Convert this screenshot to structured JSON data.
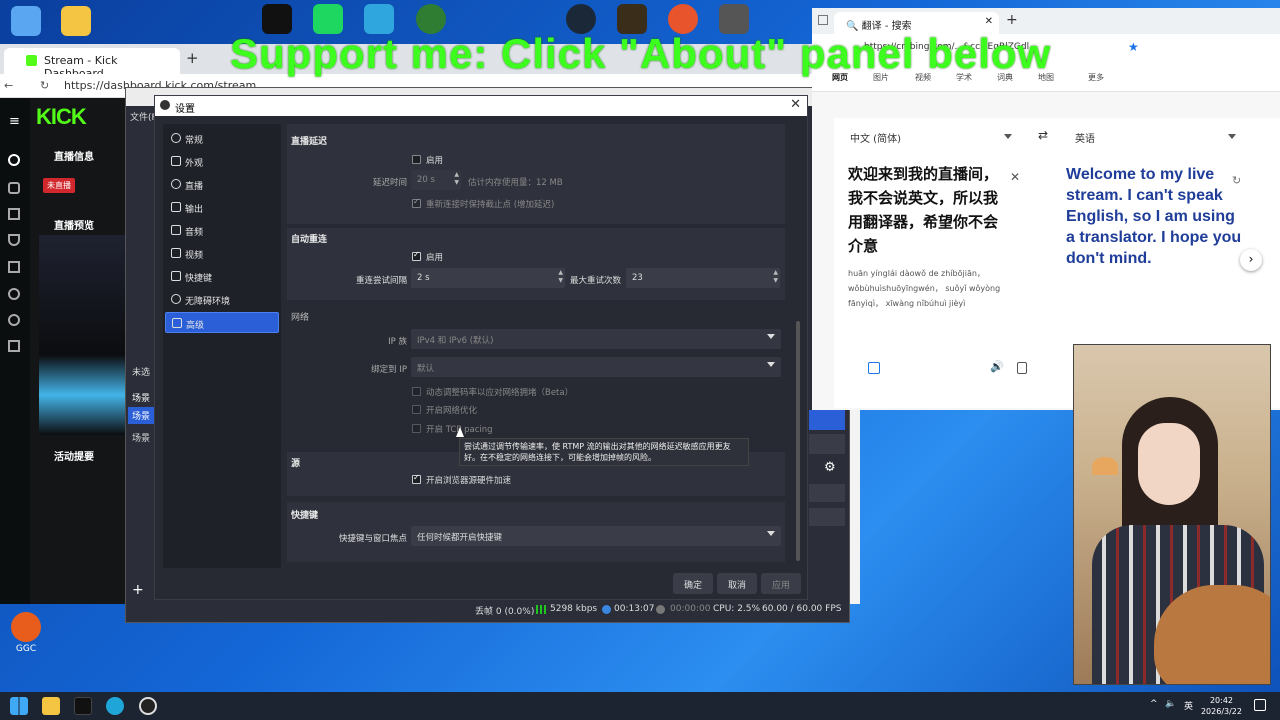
{
  "banner": "Support me: Click \"About\" panel below",
  "desktop": {
    "ggc_label": "GGC"
  },
  "left_browser": {
    "tab_title": "Stream - Kick Dashboard",
    "url": "https://dashboard.kick.com/stream",
    "kick": {
      "logo": "KICK",
      "stream_info": "直播信息",
      "not_live": "未直播",
      "preview": "直播预览",
      "activity": "活动提要"
    }
  },
  "obs": {
    "scenes_header": "未选",
    "scenes": [
      "场景",
      "场景",
      "场景"
    ],
    "menu_file": "文件(F)",
    "status": {
      "dropped": "丢帧 0 (0.0%)",
      "kbps": "5298 kbps",
      "live_time": "00:13:07",
      "rec_time": "00:00:00",
      "cpu": "CPU: 2.5%",
      "fps": "60.00 / 60.00 FPS"
    }
  },
  "settings": {
    "title": "设置",
    "nav": [
      "常规",
      "外观",
      "直播",
      "输出",
      "音频",
      "视频",
      "快捷键",
      "无障碍环境",
      "高级"
    ],
    "selected_nav": "高级",
    "stream_delay": {
      "title": "直播延迟",
      "enable_label": "启用",
      "enable_checked": false,
      "delay_label": "延迟时间",
      "delay_value": "20 s",
      "memory_estimate": "估计内存使用量：12 MB",
      "preserve_label": "重新连接时保持截止点 (增加延迟)",
      "preserve_checked": true
    },
    "auto_reconnect": {
      "title": "自动重连",
      "enable_label": "启用",
      "enable_checked": true,
      "retry_delay_label": "重连尝试间隔",
      "retry_delay_value": "2 s",
      "max_retries_label": "最大重试次数",
      "max_retries_value": "23"
    },
    "network": {
      "title": "网络",
      "ip_family_label": "IP 族",
      "ip_family_value": "IPv4 和 IPv6 (默认)",
      "bind_ip_label": "绑定到 IP",
      "bind_ip_value": "默认",
      "dynamic_bitrate": "动态调整码率以应对网络拥堵（Beta）",
      "net_optimize": "开启网络优化",
      "tcp_pacing": "开启 TCP pacing",
      "tooltip": "尝试通过调节传输速率，使 RTMP 流的输出对其他的网络延迟敏感应用更友好。在不稳定的网络连接下，可能会增加掉帧的风险。"
    },
    "sources": {
      "title": "源",
      "hw_accel_label": "开启浏览器源硬件加速",
      "hw_accel_checked": true
    },
    "hotkeys": {
      "title": "快捷键",
      "focus_label": "快捷键与窗口焦点",
      "focus_value": "任何时候都开启快捷键"
    },
    "buttons": {
      "ok": "确定",
      "cancel": "取消",
      "apply": "应用"
    }
  },
  "right_browser": {
    "tab_title": "翻译 - 搜索",
    "url_partial": "https://cn.bing.com/...&cc=EgRlZGdl...",
    "nav_tabs": [
      "网页",
      "图片",
      "视频",
      "学术",
      "词典",
      "地图",
      "更多"
    ],
    "source_lang": "中文 (简体)",
    "target_lang": "英语",
    "source_text": "欢迎来到我的直播间，我不会说英文，所以我用翻译器，希望你不会介意",
    "pinyin": "huān yínglái dàowǒ de zhíbōjiān， wǒbùhuìshuōyīngwén， suǒyǐ wǒyòng fānyìqì， xīwàng nǐbúhuì jièyì",
    "translation": "Welcome to my live stream. I can't speak English, so I am using a translator. I hope you don't mind."
  },
  "taskbar": {
    "time": "20:42",
    "date": "2026/3/22",
    "ime": "英"
  }
}
